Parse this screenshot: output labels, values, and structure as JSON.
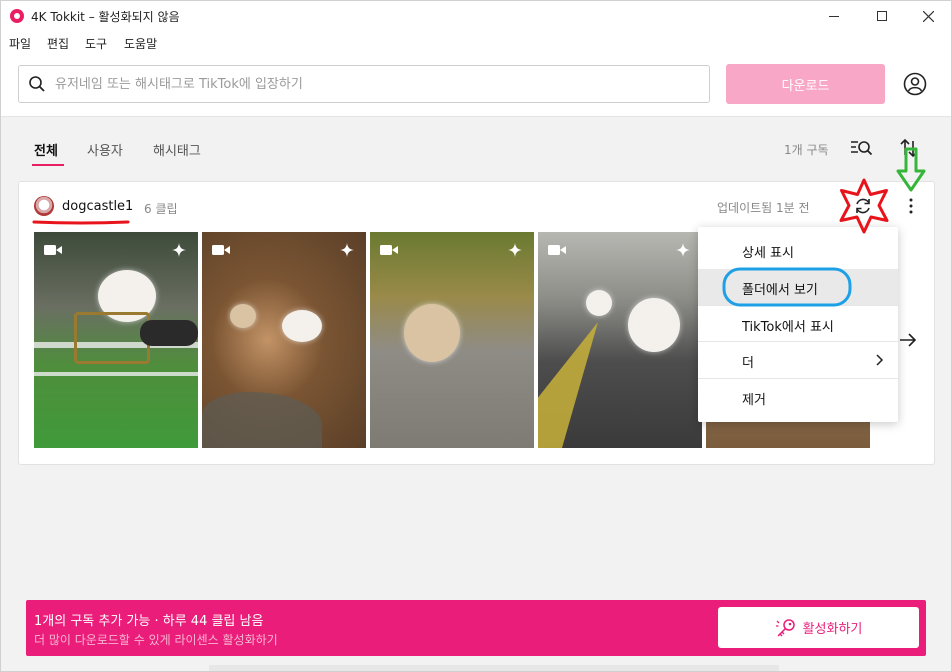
{
  "window": {
    "title": "4K Tokkit – 활성화되지 않음"
  },
  "menu": [
    "파일",
    "편집",
    "도구",
    "도움말"
  ],
  "search": {
    "placeholder": "유저네임 또는 해시태그로 TikTok에 입장하기",
    "download_label": "다운로드"
  },
  "tabs": [
    "전체",
    "사용자",
    "해시태그"
  ],
  "subscriptions_count": "1개 구독",
  "subscription": {
    "username": "dogcastle1",
    "clips": "6 클립",
    "updated": "업데이트됨 1분 전"
  },
  "context_menu": [
    "상세 표시",
    "폴더에서 보기",
    "TikTok에서 표시",
    "더",
    "제거"
  ],
  "banner": {
    "line1": "1개의 구독 추가 가능 · 하루 44 클립 남음",
    "line2": "더 많이 다운로드할 수 있게 라이센스 활성화하기",
    "activate_label": "활성화하기"
  },
  "colors": {
    "brand": "#ea1e7a",
    "download_disabled": "#f8a7c6",
    "annotation_red": "#e8141c",
    "annotation_green": "#35b53a",
    "annotation_blue": "#1ea0e6"
  }
}
